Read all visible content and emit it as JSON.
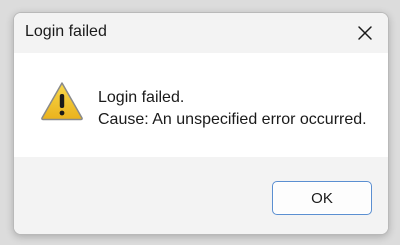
{
  "dialog": {
    "title": "Login failed",
    "close_icon": "close-icon",
    "icon": "warning-icon",
    "message_line1": "Login failed.",
    "message_line2": "Cause: An unspecified error occurred.",
    "ok_label": "OK"
  },
  "colors": {
    "warning_fill": "#f2c530",
    "warning_border": "#8a8a8a",
    "button_border": "#5b8fd1",
    "chrome_bg": "#f3f3f3"
  }
}
